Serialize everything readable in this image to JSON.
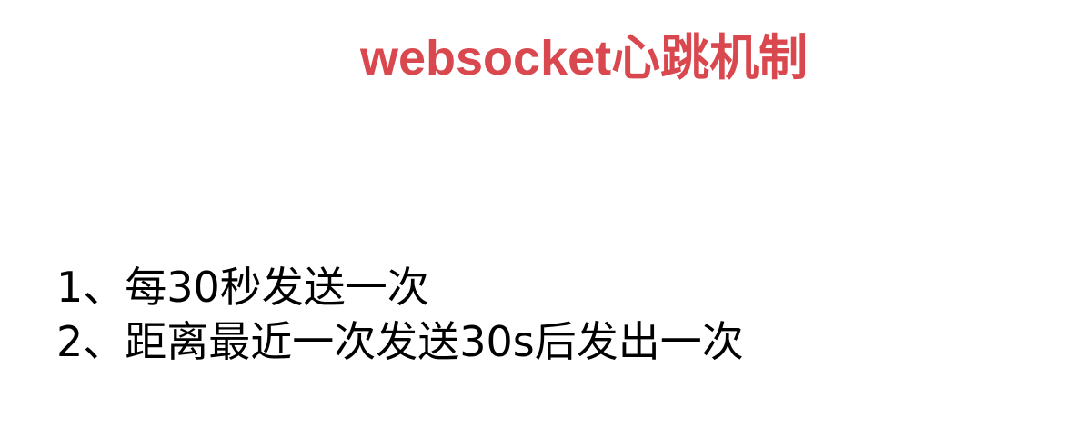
{
  "slide": {
    "title": "websocket心跳机制",
    "title_color": "#d9484e",
    "items": [
      {
        "text": "1、每30秒发送一次"
      },
      {
        "text": "2、距离最近一次发送30s后发出一次"
      }
    ]
  }
}
